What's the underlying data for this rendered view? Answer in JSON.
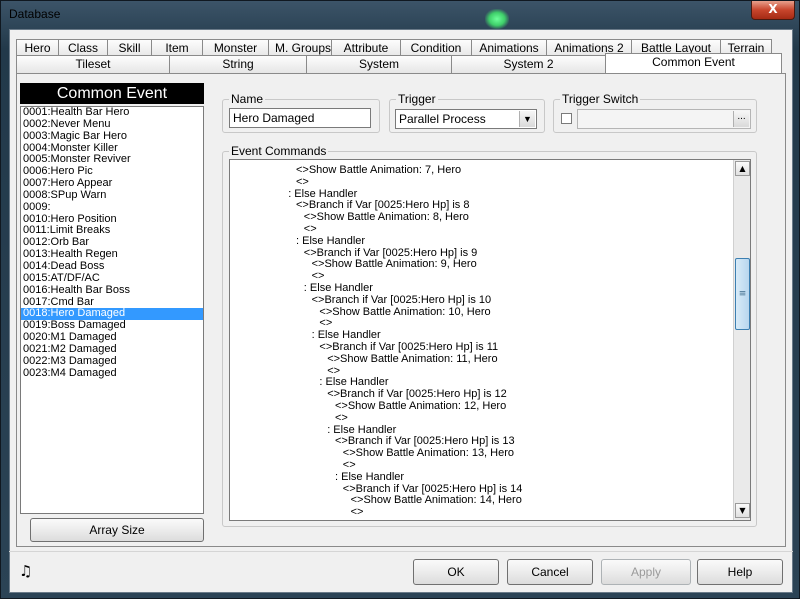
{
  "window": {
    "title": "Database",
    "close_symbol": "X"
  },
  "tabs_row1": [
    "Hero",
    "Class",
    "Skill",
    "Item",
    "Monster",
    "M. Groups",
    "Attribute",
    "Condition",
    "Animations",
    "Animations 2",
    "Battle Layout",
    "Terrain"
  ],
  "tabs_row2": [
    "Tileset",
    "String",
    "System",
    "System 2",
    "Common Event"
  ],
  "active_tab": "Common Event",
  "list": {
    "header": "Common Event",
    "items": [
      "0001:Health Bar Hero",
      "0002:Never Menu",
      "0003:Magic Bar Hero",
      "0004:Monster Killer",
      "0005:Monster Reviver",
      "0006:Hero Pic",
      "0007:Hero Appear",
      "0008:SPup Warn",
      "0009:",
      "0010:Hero Position",
      "0011:Limit Breaks",
      "0012:Orb Bar",
      "0013:Health Regen",
      "0014:Dead Boss",
      "0015:AT/DF/AC",
      "0016:Health Bar Boss",
      "0017:Cmd Bar",
      "0018:Hero Damaged",
      "0019:Boss Damaged",
      "0020:M1 Damaged",
      "0021:M2 Damaged",
      "0022:M3 Damaged",
      "0023:M4 Damaged"
    ],
    "selected": "0018:Hero Damaged",
    "array_size_label": "Array Size"
  },
  "name_group": {
    "label": "Name",
    "value": "Hero Damaged"
  },
  "trigger_group": {
    "label": "Trigger",
    "value": "Parallel Process"
  },
  "switch_group": {
    "label": "Trigger Switch",
    "browse": "..."
  },
  "commands_group": {
    "label": "Event Commands",
    "lines": [
      {
        "indent": 0,
        "text": "<>Show Battle Animation: 7, Hero"
      },
      {
        "indent": 0,
        "text": "<>"
      },
      {
        "indent": -1,
        "text": ": Else Handler"
      },
      {
        "indent": 0,
        "text": "<>Branch if Var [0025:Hero Hp] is 8"
      },
      {
        "indent": 1,
        "text": "<>Show Battle Animation: 8, Hero"
      },
      {
        "indent": 1,
        "text": "<>"
      },
      {
        "indent": 0,
        "text": ": Else Handler"
      },
      {
        "indent": 1,
        "text": "<>Branch if Var [0025:Hero Hp] is 9"
      },
      {
        "indent": 2,
        "text": "<>Show Battle Animation: 9, Hero"
      },
      {
        "indent": 2,
        "text": "<>"
      },
      {
        "indent": 1,
        "text": ": Else Handler"
      },
      {
        "indent": 2,
        "text": "<>Branch if Var [0025:Hero Hp] is 10"
      },
      {
        "indent": 3,
        "text": "<>Show Battle Animation: 10, Hero"
      },
      {
        "indent": 3,
        "text": "<>"
      },
      {
        "indent": 2,
        "text": ": Else Handler"
      },
      {
        "indent": 3,
        "text": "<>Branch if Var [0025:Hero Hp] is 11"
      },
      {
        "indent": 4,
        "text": "<>Show Battle Animation: 11, Hero"
      },
      {
        "indent": 4,
        "text": "<>"
      },
      {
        "indent": 3,
        "text": ": Else Handler"
      },
      {
        "indent": 4,
        "text": "<>Branch if Var [0025:Hero Hp] is 12"
      },
      {
        "indent": 5,
        "text": "<>Show Battle Animation: 12, Hero"
      },
      {
        "indent": 5,
        "text": "<>"
      },
      {
        "indent": 4,
        "text": ": Else Handler"
      },
      {
        "indent": 5,
        "text": "<>Branch if Var [0025:Hero Hp] is 13"
      },
      {
        "indent": 6,
        "text": "<>Show Battle Animation: 13, Hero"
      },
      {
        "indent": 6,
        "text": "<>"
      },
      {
        "indent": 5,
        "text": ": Else Handler"
      },
      {
        "indent": 6,
        "text": "<>Branch if Var [0025:Hero Hp] is 14"
      },
      {
        "indent": 7,
        "text": "<>Show Battle Animation: 14, Hero"
      },
      {
        "indent": 7,
        "text": "<>"
      }
    ]
  },
  "buttons": {
    "ok": "OK",
    "cancel": "Cancel",
    "apply": "Apply",
    "help": "Help"
  },
  "icons": {
    "music": "music-note-icon",
    "scroll_up": "up-arrow-icon",
    "scroll_down": "down-arrow-icon",
    "dropdown": "chevron-down-icon"
  }
}
